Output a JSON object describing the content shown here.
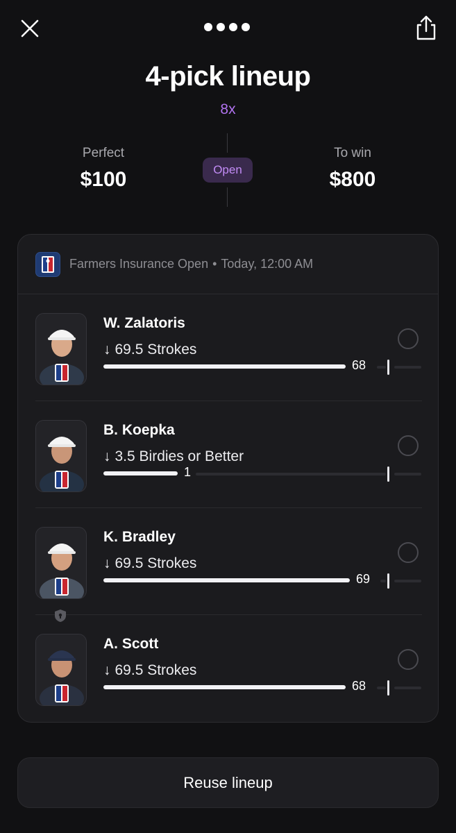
{
  "header": {
    "close_icon": "close-icon",
    "page_dots": 4,
    "share_icon": "share-icon"
  },
  "lineup": {
    "title": "4-pick lineup",
    "multiplier": "8x",
    "perfect_label": "Perfect",
    "perfect_value": "$100",
    "status": "Open",
    "towin_label": "To win",
    "towin_value": "$800"
  },
  "event": {
    "name": "Farmers Insurance Open",
    "separator": "•",
    "time": "Today, 12:00 AM",
    "logo_icon": "pga-tour-logo"
  },
  "picks": [
    {
      "name": "W. Zalatoris",
      "direction": "↓",
      "line": "69.5 Strokes",
      "current": "68",
      "progress": 0.93
    },
    {
      "name": "B. Koepka",
      "direction": "↓",
      "line": "3.5 Birdies or Better",
      "current": "1",
      "progress": 0.29
    },
    {
      "name": "K. Bradley",
      "direction": "↓",
      "line": "69.5 Strokes",
      "current": "69",
      "progress": 0.96
    },
    {
      "name": "A. Scott",
      "direction": "↓",
      "line": "69.5 Strokes",
      "current": "68",
      "progress": 0.93
    }
  ],
  "colors": {
    "background": "#111113",
    "accent_purple": "#b173f0",
    "badge_bg": "#3a2a4d",
    "card_bg": "#1b1b1e"
  },
  "footer": {
    "reuse_label": "Reuse lineup"
  }
}
